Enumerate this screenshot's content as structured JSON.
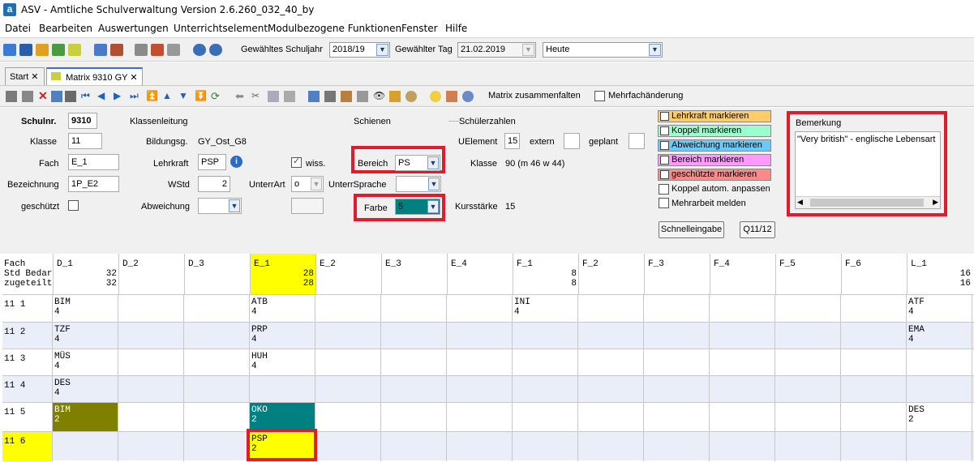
{
  "app": {
    "title": "ASV - Amtliche Schulverwaltung Version 2.6.260_032_40_by",
    "icon_letter": "a"
  },
  "menu": [
    "Datei",
    "Bearbeiten",
    "Auswertungen",
    "Unterrichtselement",
    "Modulbezogene Funktionen",
    "Fenster",
    "Hilfe"
  ],
  "toolbar": {
    "schuljahr_label": "Gewähltes Schuljahr",
    "schuljahr_value": "2018/19",
    "tag_label": "Gewählter Tag",
    "tag_value": "21.02.2019",
    "heute_value": "Heute"
  },
  "tabs": [
    {
      "label": "Start",
      "close": "✕"
    },
    {
      "label": "Matrix 9310 GY",
      "close": "✕"
    }
  ],
  "subtoolbar": {
    "collapse_label": "Matrix zusammenfalten",
    "multi_label": "Mehrfachänderung"
  },
  "form": {
    "schulnr_label": "Schulnr.",
    "schulnr_value": "9310",
    "klasse_label": "Klasse",
    "klasse_value": "11",
    "fach_label": "Fach",
    "fach_value": "E_1",
    "bezeichnung_label": "Bezeichnung",
    "bezeichnung_value": "1P_E2",
    "geschuetzt_label": "geschützt",
    "klassenleitung_label": "Klassenleitung",
    "bildungsg_label": "Bildungsg.",
    "bildungsg_value": "GY_Ost_G8",
    "lehrkraft_label": "Lehrkraft",
    "lehrkraft_value": "PSP",
    "wstd_label": "WStd",
    "wstd_value": "2",
    "abweichung_label": "Abweichung",
    "wiss_label": "wiss.",
    "unterrart_label": "UnterrArt",
    "unterrart_value": "o",
    "unterrsprache_label": "UnterrSprache",
    "schienen_label": "Schienen",
    "bereich_label": "Bereich",
    "bereich_value": "PS",
    "farbe_label": "Farbe",
    "farbe_value": "5",
    "schuelerzahlen_label": "Schülerzahlen",
    "uelement_label": "UElement",
    "uelement_value": "15",
    "extern_label": "extern",
    "geplant_label": "geplant",
    "klasse2_label": "Klasse",
    "klasse2_value": "90 (m 46 w 44)",
    "kursstaerke_label": "Kursstärke",
    "kursstaerke_value": "15",
    "markers": [
      {
        "label": "Lehrkraft markieren",
        "color": "#ffcc66"
      },
      {
        "label": "Koppel markieren",
        "color": "#99ffcc"
      },
      {
        "label": "Abweichung markieren",
        "color": "#66ccff"
      },
      {
        "label": "Bereich markieren",
        "color": "#ff99ff"
      },
      {
        "label": "geschützte markieren",
        "color": "#ff8888"
      }
    ],
    "koppel_auto_label": "Koppel autom. anpassen",
    "mehrarbeit_label": "Mehrarbeit melden",
    "schnelleingabe_label": "Schnelleingabe",
    "q1112_label": "Q11/12",
    "bemerkung_label": "Bemerkung",
    "bemerkung_value": "\"Very british\" - englische Lebensart"
  },
  "grid": {
    "row_header": "Fach\nStd Bedar\nzugeteilt",
    "columns": [
      {
        "name": "D_1",
        "bedarf": "32",
        "zugeteilt": "32"
      },
      {
        "name": "D_2",
        "bedarf": "",
        "zugeteilt": ""
      },
      {
        "name": "D_3",
        "bedarf": "",
        "zugeteilt": ""
      },
      {
        "name": "E_1",
        "bedarf": "28",
        "zugeteilt": "28"
      },
      {
        "name": "E_2",
        "bedarf": "",
        "zugeteilt": ""
      },
      {
        "name": "E_3",
        "bedarf": "",
        "zugeteilt": ""
      },
      {
        "name": "E_4",
        "bedarf": "",
        "zugeteilt": ""
      },
      {
        "name": "F_1",
        "bedarf": "8",
        "zugeteilt": "8"
      },
      {
        "name": "F_2",
        "bedarf": "",
        "zugeteilt": ""
      },
      {
        "name": "F_3",
        "bedarf": "",
        "zugeteilt": ""
      },
      {
        "name": "F_4",
        "bedarf": "",
        "zugeteilt": ""
      },
      {
        "name": "F_5",
        "bedarf": "",
        "zugeteilt": ""
      },
      {
        "name": "F_6",
        "bedarf": "",
        "zugeteilt": ""
      },
      {
        "name": "L_1",
        "bedarf": "16",
        "zugeteilt": "16"
      }
    ],
    "rows": [
      {
        "label": "11 1",
        "cells": {
          "0": "BIM\n4",
          "3": "ATB\n4",
          "7": "INI\n4",
          "13": "ATF\n4"
        }
      },
      {
        "label": "11 2",
        "cells": {
          "0": "TZF\n4",
          "3": "PRP\n4",
          "13": "EMA\n4"
        }
      },
      {
        "label": "11 3",
        "cells": {
          "0": "MÜS\n4",
          "3": "HUH\n4"
        }
      },
      {
        "label": "11 4",
        "cells": {
          "0": "DES\n4"
        }
      },
      {
        "label": "11 5",
        "cells": {
          "0": "BIM\n2",
          "3": "OKO\n2",
          "13": "DES\n2"
        }
      },
      {
        "label": "11 6",
        "cells": {
          "3": "PSP\n2"
        }
      }
    ],
    "colors": {
      "highlight": "#ffff00",
      "olive": "#808000",
      "teal": "#008080",
      "alt_row": "#e9eef8"
    }
  }
}
